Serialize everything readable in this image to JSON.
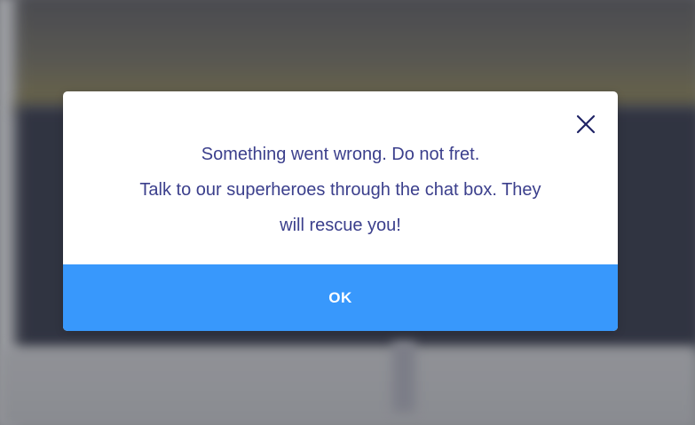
{
  "dialog": {
    "message_line_1": "Something went wrong. Do not fret.",
    "message_line_2": "Talk to our superheroes through the chat box. They",
    "message_line_3": "will rescue you!",
    "ok_label": "OK",
    "close_icon": "close-icon"
  },
  "colors": {
    "text": "#3b3f8c",
    "ok_button": "#3898fc",
    "close_icon": "#1f2366"
  }
}
